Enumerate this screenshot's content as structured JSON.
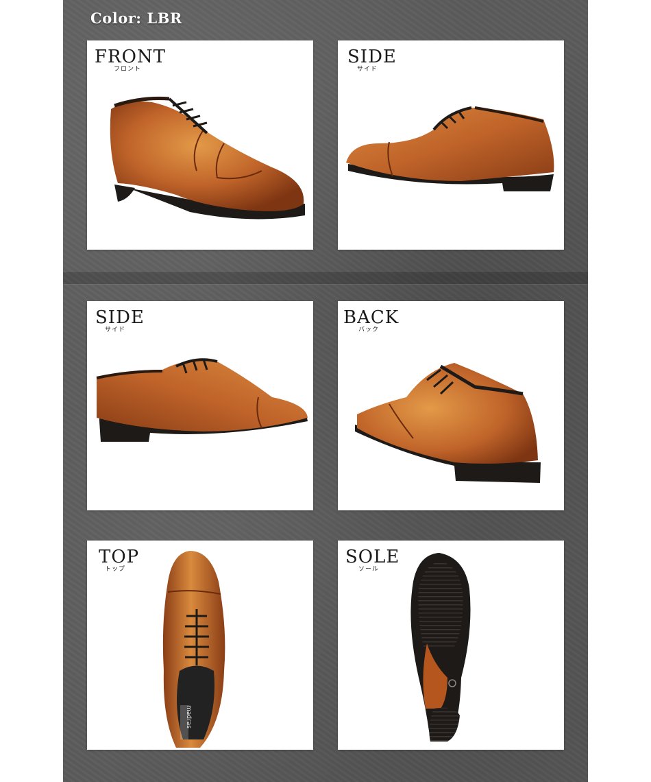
{
  "color_label": "Color: LBR",
  "views": [
    {
      "title": "FRONT",
      "sub": "フロント",
      "icon": "oxford-shoe-front-three-quarter"
    },
    {
      "title": "SIDE",
      "sub": "サイド",
      "icon": "oxford-shoe-side-left"
    },
    {
      "title": "SIDE",
      "sub": "サイド",
      "icon": "oxford-shoe-side-right"
    },
    {
      "title": "BACK",
      "sub": "バック",
      "icon": "oxford-shoe-back-three-quarter"
    },
    {
      "title": "TOP",
      "sub": "トップ",
      "icon": "oxford-shoe-top"
    },
    {
      "title": "SOLE",
      "sub": "ソール",
      "icon": "oxford-shoe-sole"
    }
  ],
  "insole_brand": "madras",
  "colors": {
    "leather": "#b5561f",
    "leather_light": "#d98a3e",
    "sole": "#1e1a18",
    "background": "#5b5b5b"
  }
}
